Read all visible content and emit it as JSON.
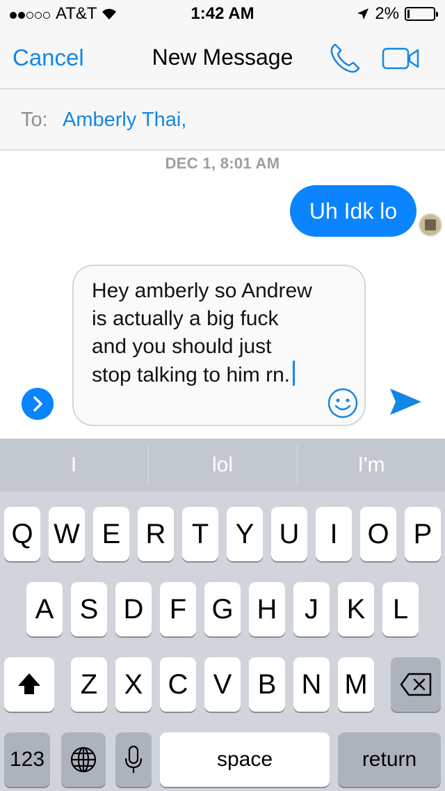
{
  "status_bar": {
    "carrier": "AT&T",
    "time": "1:42 AM",
    "battery": "2%"
  },
  "nav": {
    "cancel": "Cancel",
    "title": "New Message",
    "call_icon": "phone-icon",
    "video_icon": "video-camera-icon"
  },
  "to_row": {
    "label": "To:",
    "recipient": "Amberly Thai,"
  },
  "conversation": {
    "timestamp": "DEC 1, 8:01 AM",
    "messages": [
      {
        "from": "me",
        "text": "Uh Idk lo"
      }
    ]
  },
  "composer": {
    "text": "Hey amberly so Andrew is actually a big fuck and you should just stop talking to him rn."
  },
  "suggestions": [
    "I",
    "lol",
    "I'm"
  ],
  "keyboard": {
    "row1": [
      "Q",
      "W",
      "E",
      "R",
      "T",
      "Y",
      "U",
      "I",
      "O",
      "P"
    ],
    "row2": [
      "A",
      "S",
      "D",
      "F",
      "G",
      "H",
      "J",
      "K",
      "L"
    ],
    "row3": [
      "Z",
      "X",
      "C",
      "V",
      "B",
      "N",
      "M"
    ],
    "numbers": "123",
    "space": "space",
    "return": "return"
  },
  "colors": {
    "accent": "#1287e6",
    "bubble": "#0a84ff",
    "keyboard_bg": "#d1d5db"
  }
}
